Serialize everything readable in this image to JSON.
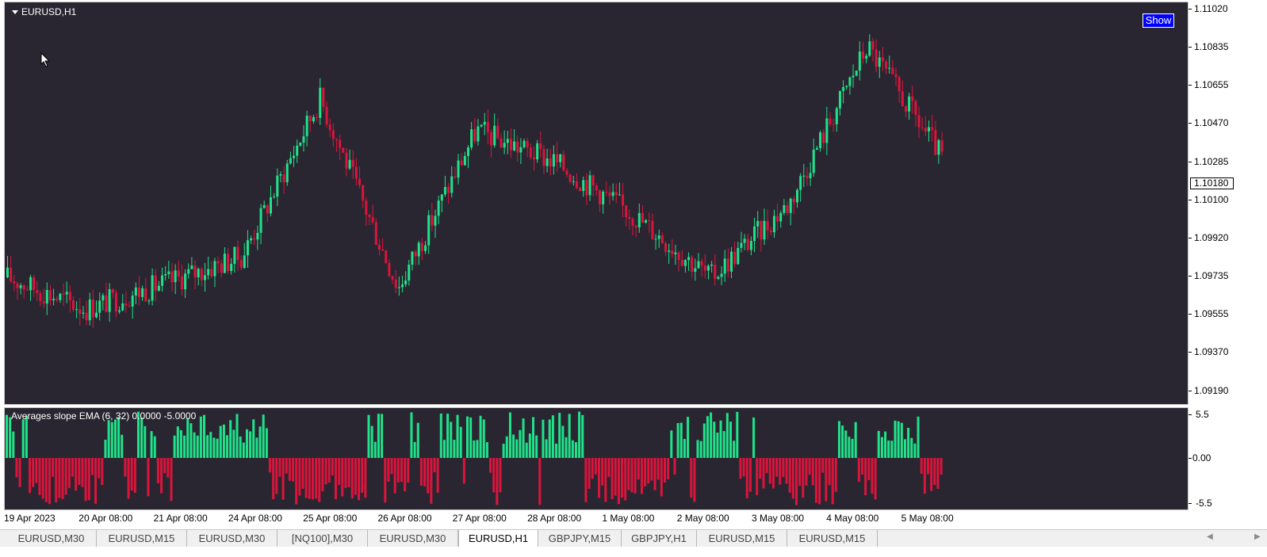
{
  "window": {
    "symbol_title": "EURUSD,H1",
    "show_button": "Show"
  },
  "indicator": {
    "label": "Averages slope EMA (6, 32) 0.0000 -5.0000"
  },
  "colors": {
    "background": "#2a2631",
    "bull": "#1ee38a",
    "bear": "#dc143c",
    "axis_text": "#000000"
  },
  "price_axis": {
    "ticks": [
      "1.11020",
      "1.10835",
      "1.10655",
      "1.10470",
      "1.10285",
      "1.10100",
      "1.09920",
      "1.09735",
      "1.09555",
      "1.09370",
      "1.09190"
    ],
    "current_price": "1.10180"
  },
  "indicator_axis": {
    "ticks": [
      "5.5",
      "0.00",
      "-5.5"
    ]
  },
  "time_axis": {
    "labels": [
      "19 Apr 2023",
      "20 Apr 08:00",
      "21 Apr 08:00",
      "24 Apr 08:00",
      "25 Apr 08:00",
      "26 Apr 08:00",
      "27 Apr 08:00",
      "28 Apr 08:00",
      "1 May 08:00",
      "2 May 08:00",
      "3 May 08:00",
      "4 May 08:00",
      "5 May 08:00"
    ]
  },
  "tabs": [
    {
      "label": "EURUSD,M30",
      "active": false
    },
    {
      "label": "EURUSD,M15",
      "active": false
    },
    {
      "label": "EURUSD,M30",
      "active": false
    },
    {
      "label": "[NQ100],M30",
      "active": false
    },
    {
      "label": "EURUSD,M30",
      "active": false
    },
    {
      "label": "EURUSD,H1",
      "active": true
    },
    {
      "label": "GBPJPY,M15",
      "active": false
    },
    {
      "label": "GBPJPY,H1",
      "active": false
    },
    {
      "label": "EURUSD,M15",
      "active": false
    },
    {
      "label": "EURUSD,M15",
      "active": false
    }
  ],
  "chart_data": {
    "type": "candlestick",
    "title": "EURUSD,H1",
    "ylim": [
      1.0914,
      1.1105
    ],
    "series": [
      {
        "x": "19 Apr 2023",
        "close": 1.0975
      },
      {
        "x": "20 Apr 08:00",
        "close": 1.096
      },
      {
        "x": "21 Apr 08:00",
        "close": 1.0972
      },
      {
        "x": "24 Apr 08:00",
        "close": 1.0985
      },
      {
        "x": "25 Apr 08:00",
        "close": 1.106
      },
      {
        "x": "26 Apr 08:00",
        "close": 1.097
      },
      {
        "x": "27 Apr 08:00",
        "close": 1.1045
      },
      {
        "x": "28 Apr 08:00",
        "close": 1.103
      },
      {
        "x": "1 May 08:00",
        "close": 1.1005
      },
      {
        "x": "2 May 08:00",
        "close": 1.0975
      },
      {
        "x": "3 May 08:00",
        "close": 1.101
      },
      {
        "x": "4 May 08:00",
        "close": 1.1085
      },
      {
        "x": "5 May 08:00",
        "close": 1.103
      }
    ],
    "last_price": 1.1018,
    "indicator": {
      "name": "Averages slope EMA (6, 32)",
      "ylim": [
        -5.5,
        5.5
      ]
    }
  }
}
